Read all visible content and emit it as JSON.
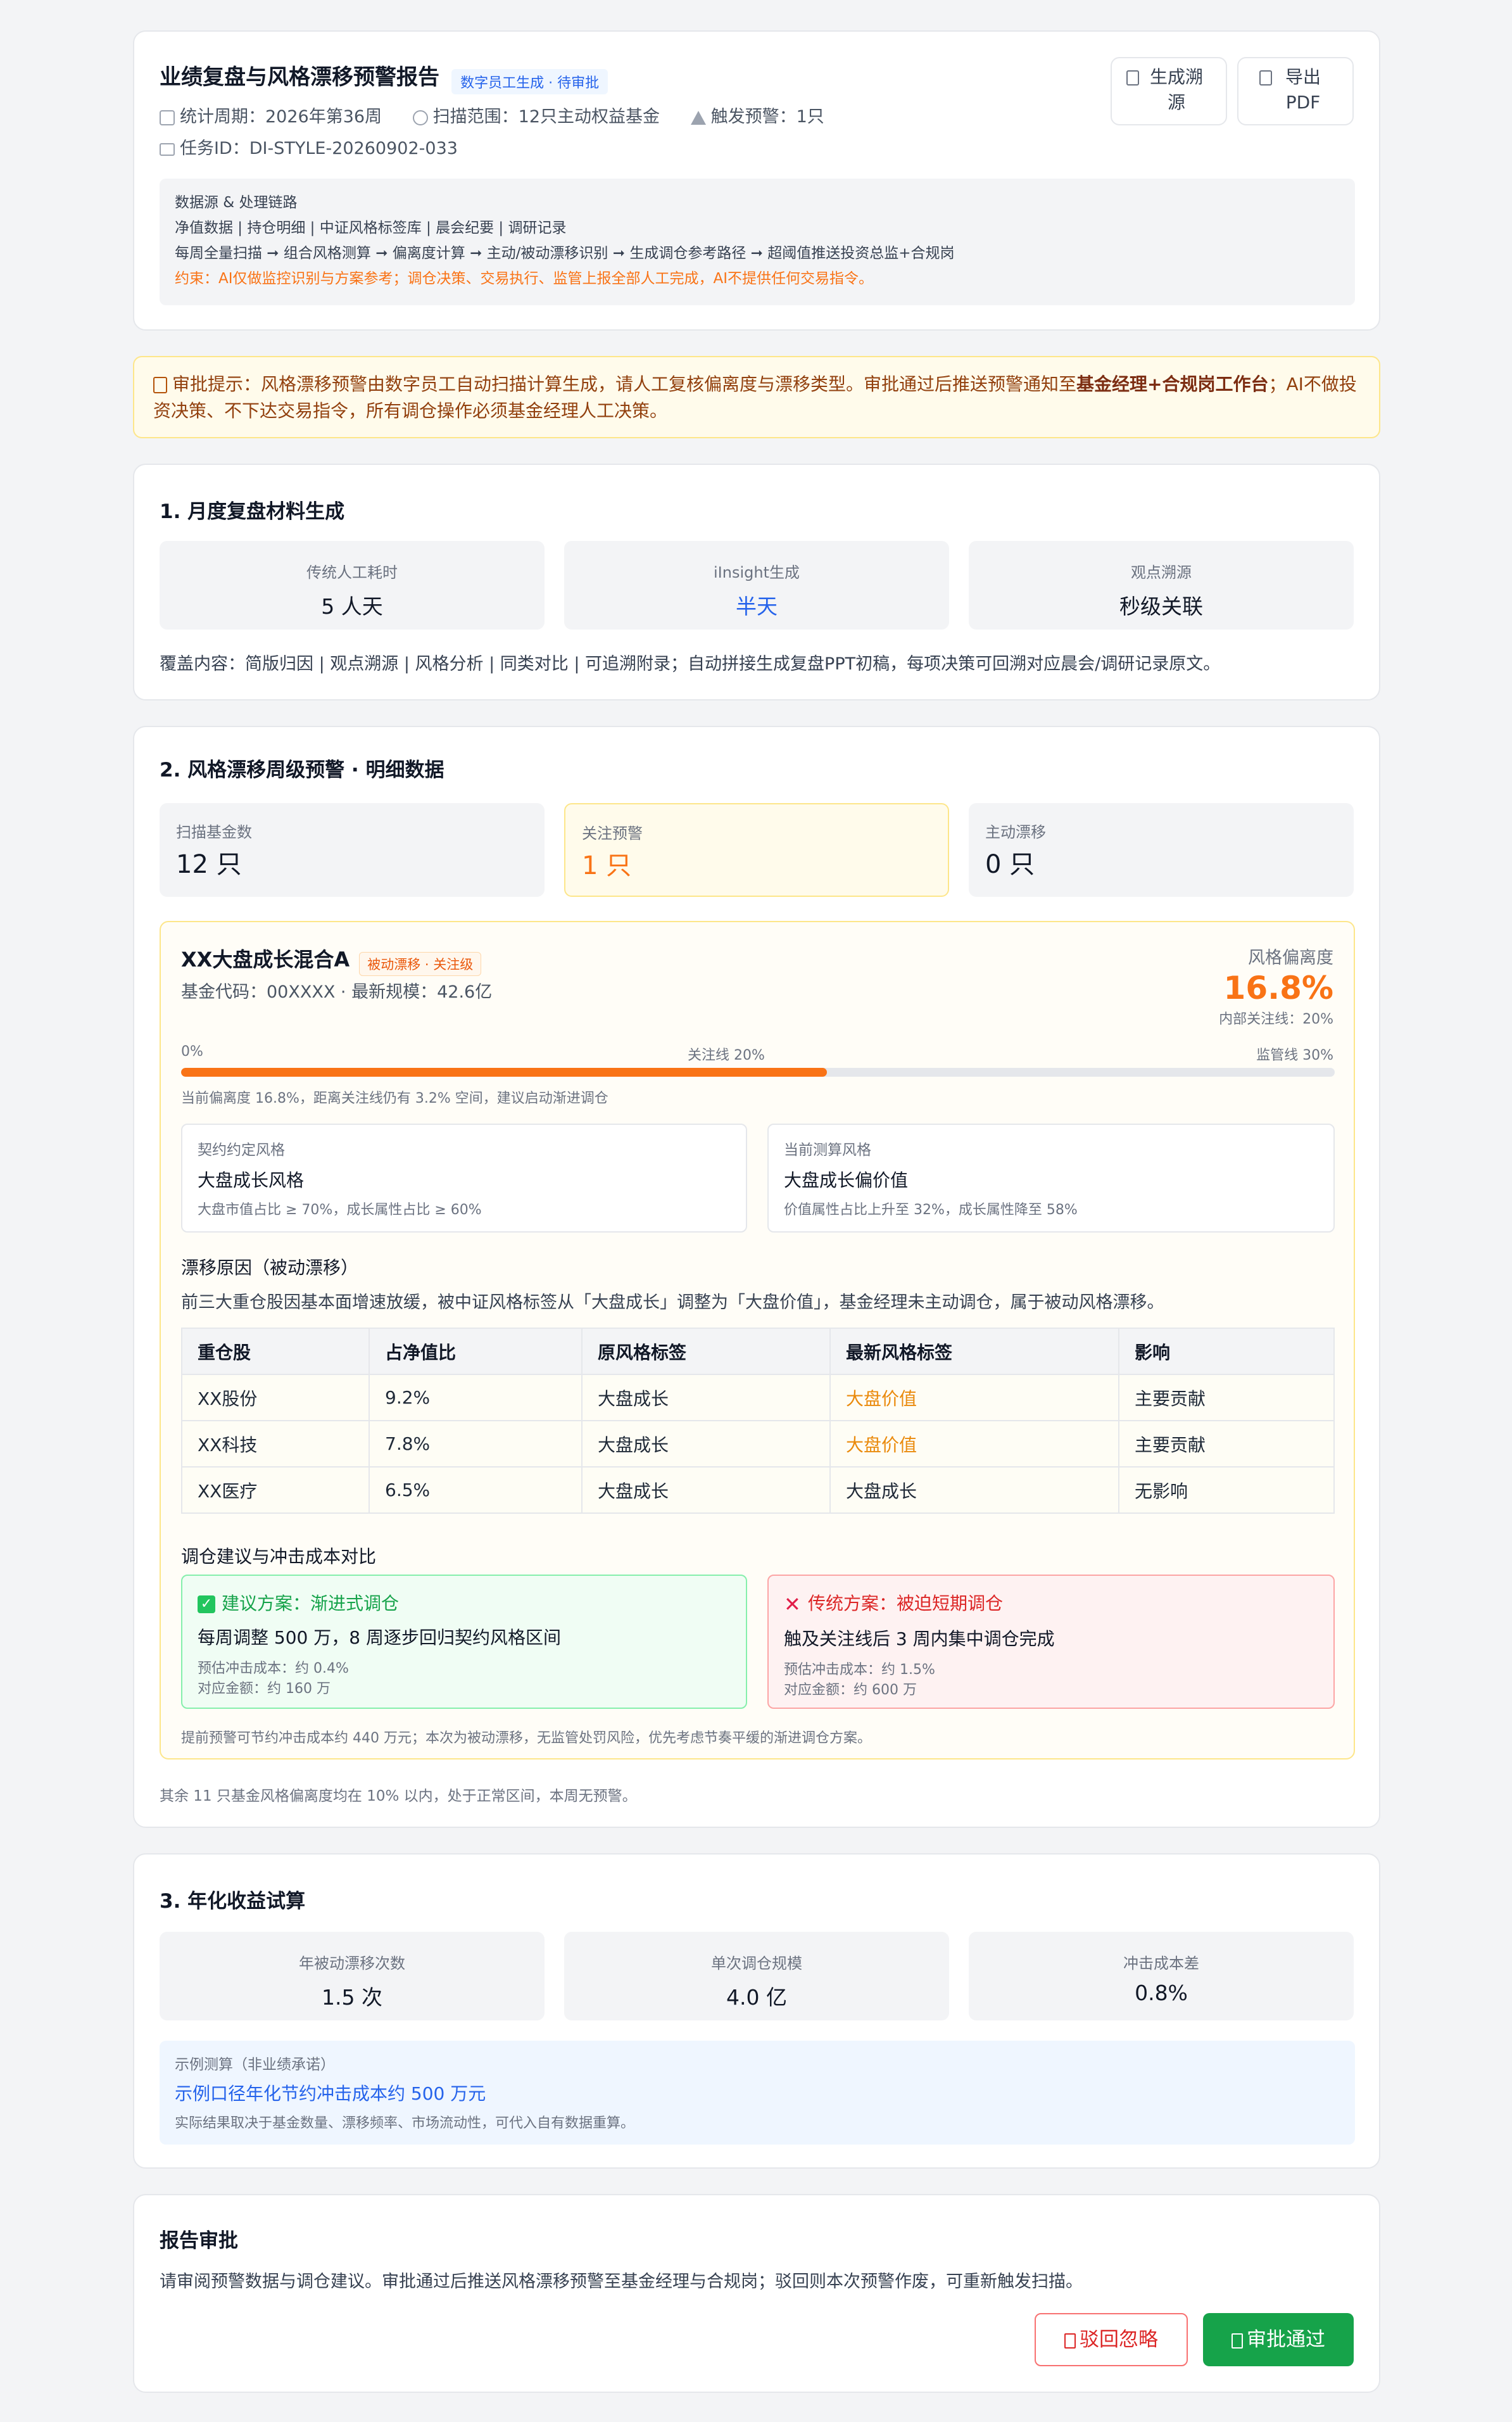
{
  "header": {
    "title": "业绩复盘与风格漂移预警报告",
    "status_badge": "数字员工生成 · 待审批",
    "period": "统计周期：2026年第36周",
    "scope": "扫描范围：12只主动权益基金",
    "alerts": "触发预警：1只",
    "task_id": "任务ID：DI-STYLE-20260902-033",
    "btn_trace": "生成溯源",
    "btn_export": "导出PDF",
    "datasource": {
      "title": "数据源 & 处理链路",
      "sources": "净值数据 | 持仓明细 | 中证风格标签库 | 晨会纪要 | 调研记录",
      "pipeline": "每周全量扫描 ➞ 组合风格测算 ➞ 偏离度计算 ➞ 主动/被动漂移识别 ➞ 生成调仓参考路径 ➞ 超阈值推送投资总监+合规岗",
      "constraint": "约束：AI仅做监控识别与方案参考；调仓决策、交易执行、监管上报全部人工完成，AI不提供任何交易指令。"
    }
  },
  "notice": {
    "pre": "审批提示：风格漂移预警由数字员工自动扫描计算生成，请人工复核偏离度与漂移类型。审批通过后推送预警通知至",
    "strong": "基金经理+合规岗工作台",
    "post": "；AI不做投资决策、不下达交易指令，所有调仓操作必须基金经理人工决策。"
  },
  "section1": {
    "title": "1. 月度复盘材料生成",
    "stats": [
      {
        "label": "传统人工耗时",
        "value": "5 人天"
      },
      {
        "label": "iInsight生成",
        "value": "半天"
      },
      {
        "label": "观点溯源",
        "value": "秒级关联"
      }
    ],
    "coverage": "覆盖内容：简版归因 | 观点溯源 | 风格分析 | 同类对比 | 可追溯附录；自动拼接生成复盘PPT初稿，每项决策可回溯对应晨会/调研记录原文。"
  },
  "section2": {
    "title": "2. 风格漂移周级预警 · 明细数据",
    "stats": [
      {
        "label": "扫描基金数",
        "value": "12 只"
      },
      {
        "label": "关注预警",
        "value": "1 只"
      },
      {
        "label": "主动漂移",
        "value": "0 只"
      }
    ],
    "fund": {
      "name": "XX大盘成长混合A",
      "tag": "被动漂移 · 关注级",
      "meta": "基金代码：00XXXX · 最新规模：42.6亿",
      "deviation_label": "风格偏离度",
      "deviation_value": "16.8%",
      "internal_line": "内部关注线：20%",
      "deviation_fraction": 0.56,
      "bar_labels": {
        "start": "0%",
        "watch": "关注线 20%",
        "reg": "监管线 30%"
      },
      "bar_note": "当前偏离度 16.8%，距离关注线仍有 3.2% 空间，建议启动渐进调仓",
      "contract_style": {
        "label": "契约约定风格",
        "value": "大盘成长风格",
        "note": "大盘市值占比 ≥ 70%，成长属性占比 ≥ 60%"
      },
      "current_style": {
        "label": "当前测算风格",
        "value": "大盘成长偏价值",
        "note": "价值属性占比上升至 32%，成长属性降至 58%"
      },
      "reason_title": "漂移原因（被动漂移）",
      "reason": "前三大重仓股因基本面增速放缓，被中证风格标签从「大盘成长」调整为「大盘价值」，基金经理未主动调仓，属于被动风格漂移。",
      "table": {
        "headers": [
          "重仓股",
          "占净值比",
          "原风格标签",
          "最新风格标签",
          "影响"
        ],
        "rows": [
          {
            "stock": "XX股份",
            "ratio": "9.2%",
            "orig": "大盘成长",
            "latest": "大盘价值",
            "impact": "主要贡献",
            "changed": true
          },
          {
            "stock": "XX科技",
            "ratio": "7.8%",
            "orig": "大盘成长",
            "latest": "大盘价值",
            "impact": "主要贡献",
            "changed": true
          },
          {
            "stock": "XX医疗",
            "ratio": "6.5%",
            "orig": "大盘成长",
            "latest": "大盘成长",
            "impact": "无影响",
            "changed": false
          }
        ]
      },
      "compare_title": "调仓建议与冲击成本对比",
      "plan_good": {
        "title": "建议方案：渐进式调仓",
        "desc": "每周调整 500 万，8 周逐步回归契约风格区间",
        "cost": "预估冲击成本：约 0.4%",
        "amount": "对应金额：约 160 万"
      },
      "plan_bad": {
        "title": "传统方案：被迫短期调仓",
        "desc": "触及关注线后 3 周内集中调仓完成",
        "cost": "预估冲击成本：约 1.5%",
        "amount": "对应金额：约 600 万"
      },
      "footnote": "提前预警可节约冲击成本约 440 万元；本次为被动漂移，无监管处罚风险，优先考虑节奏平缓的渐进调仓方案。"
    },
    "others_note": "其余 11 只基金风格偏离度均在 10% 以内，处于正常区间，本周无预警。"
  },
  "section3": {
    "title": "3. 年化收益试算",
    "stats": [
      {
        "label": "年被动漂移次数",
        "value": "1.5 次"
      },
      {
        "label": "单次调仓规模",
        "value": "4.0 亿"
      },
      {
        "label": "冲击成本差",
        "value": "0.8%"
      }
    ],
    "example_label": "示例测算（非业绩承诺）",
    "example_value": "示例口径年化节约冲击成本约 500 万元",
    "example_note": "实际结果取决于基金数量、漂移频率、市场流动性，可代入自有数据重算。"
  },
  "approval": {
    "title": "报告审批",
    "desc": "请审阅预警数据与调仓建议。审批通过后推送风格漂移预警至基金经理与合规岗；驳回则本次预警作废，可重新触发扫描。",
    "reject": "驳回忽略",
    "approve": "审批通过"
  },
  "colors": {
    "accent_orange": "#f97316",
    "approve_green": "#16a34a",
    "reject_red": "#dc2626",
    "link_blue": "#2563eb"
  }
}
